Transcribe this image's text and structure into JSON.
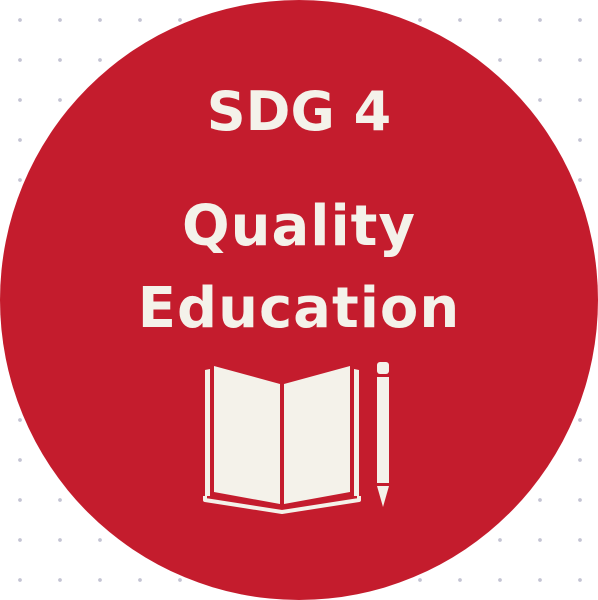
{
  "badge": {
    "code": "SDG 4",
    "title_line_1": "Quality",
    "title_line_2": "Education",
    "background_color": "#c41c2d",
    "text_color": "#f4f2ea",
    "icons": [
      "open-book-icon",
      "pencil-icon"
    ]
  },
  "page": {
    "dot_color": "#c4c4d4"
  }
}
